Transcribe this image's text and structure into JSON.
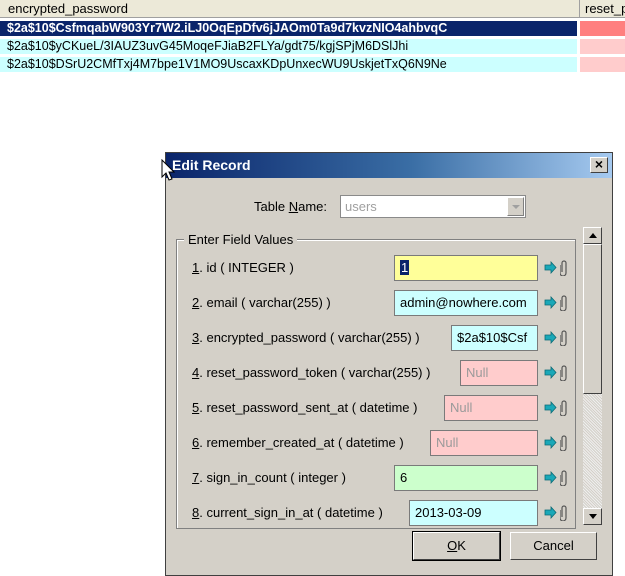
{
  "grid": {
    "columns": [
      "encrypted_password",
      "reset_p"
    ],
    "rows": [
      "$2a$10$CsfmqabW903Yr7W2.iLJ0OqEpDfv6jJAOm0Ta9d7kvzNIO4ahbvqC",
      "$2a$10$yCKueL/3IAUZ3uvG45MoqeFJiaB2FLYa/gdt75/kgjSPjM6DSlJhi",
      "$2a$10$DSrU2CMfTxj4M7bpe1V1MO9UscaxKDpUnxecWU9UskjetTxQ6N9Ne"
    ],
    "selected_row": 0
  },
  "dialog": {
    "title": "Edit Record",
    "close_label": "×",
    "table_name_label_pre": "Table ",
    "table_name_label_mnemonic": "N",
    "table_name_label_post": "ame:",
    "table_name_value": "users",
    "group_label": "Enter Field Values",
    "fields": [
      {
        "num": "1",
        "label": ". id ( INTEGER )",
        "value": "1"
      },
      {
        "num": "2",
        "label": ". email ( varchar(255) )",
        "value": "admin@nowhere.com"
      },
      {
        "num": "3",
        "label": ". encrypted_password ( varchar(255) )",
        "value": "$2a$10$Csf"
      },
      {
        "num": "4",
        "label": ". reset_password_token ( varchar(255) )",
        "value": "Null"
      },
      {
        "num": "5",
        "label": ". reset_password_sent_at ( datetime )",
        "value": "Null"
      },
      {
        "num": "6",
        "label": ". remember_created_at ( datetime )",
        "value": "Null"
      },
      {
        "num": "7",
        "label": ". sign_in_count ( integer )",
        "value": "6"
      },
      {
        "num": "8",
        "label": ". current_sign_in_at ( datetime )",
        "value": "2013-03-09"
      }
    ],
    "ok_mnemonic": "O",
    "ok_rest": "K",
    "cancel_label": "Cancel"
  },
  "colors": {
    "selection": "#0a246a",
    "cyan": "#ccffff",
    "pink": "#ffcccc",
    "yellow": "#ffff99",
    "green": "#ccffcc"
  },
  "icons": [
    "go-arrow-icon",
    "paperclip-icon",
    "close-icon",
    "dropdown-arrow-icon",
    "mouse-cursor-icon"
  ]
}
